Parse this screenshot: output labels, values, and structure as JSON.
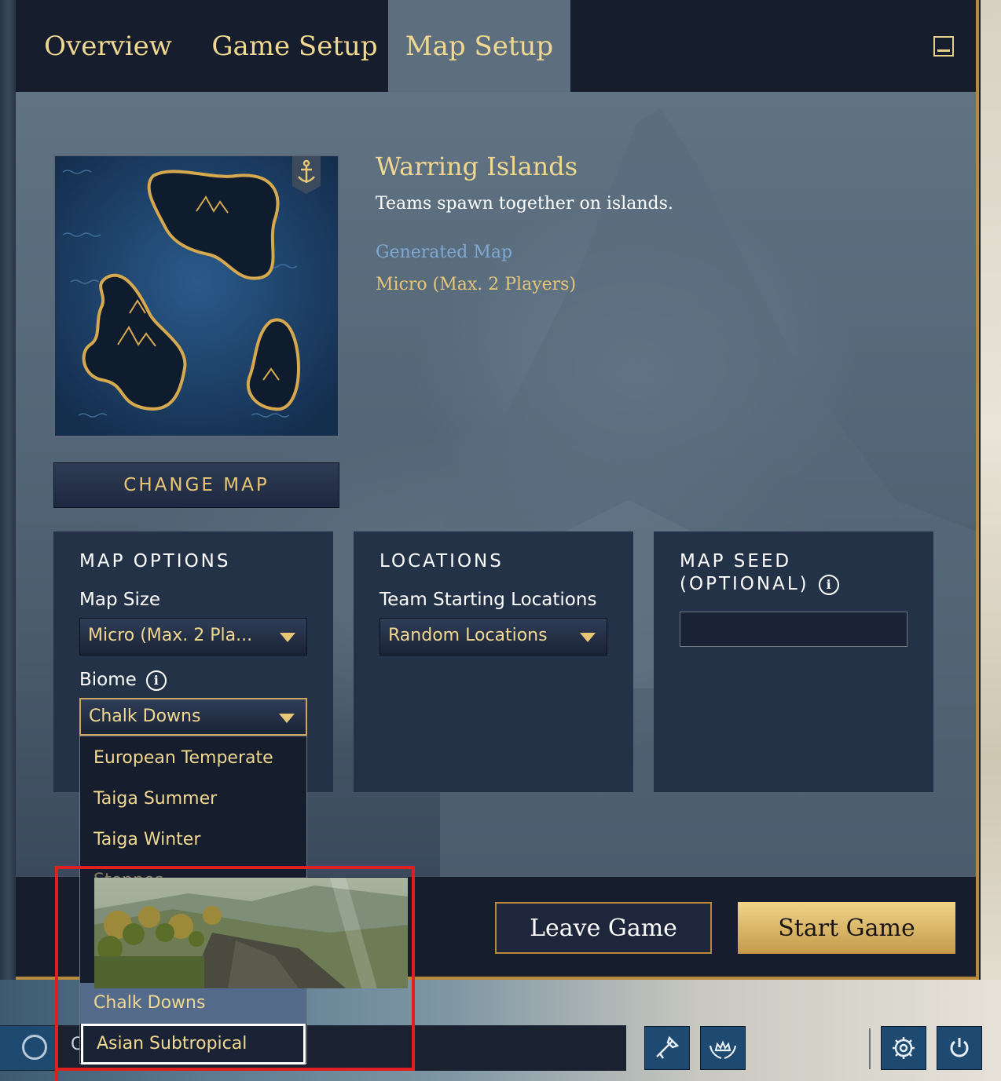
{
  "tabs": [
    {
      "label": "Overview"
    },
    {
      "label": "Game Setup"
    },
    {
      "label": "Map Setup",
      "active": true
    }
  ],
  "map": {
    "title": "Warring Islands",
    "description": "Teams spawn together on islands.",
    "type": "Generated Map",
    "size": "Micro (Max. 2 Players)",
    "change_button": "CHANGE MAP"
  },
  "map_options": {
    "heading": "MAP OPTIONS",
    "size_label": "Map Size",
    "size_value": "Micro (Max. 2 Pla...",
    "biome_label": "Biome",
    "biome_value": "Chalk Downs",
    "biome_options": [
      "European Temperate",
      "Taiga Summer",
      "Taiga Winter",
      "Steppes",
      "Chalk Downs",
      "Asian Subtropical"
    ],
    "biome_selected": "Chalk Downs",
    "biome_hovered": "Asian Subtropical"
  },
  "locations": {
    "heading": "LOCATIONS",
    "label": "Team Starting Locations",
    "value": "Random Locations"
  },
  "seed": {
    "heading_line1": "MAP SEED",
    "heading_line2": "(OPTIONAL)",
    "value": ""
  },
  "actions": {
    "leave": "Leave Game",
    "start": "Start Game"
  },
  "chat": {
    "initial": "C"
  },
  "colors": {
    "gold": "#f0d890",
    "accent_blue": "#7fa8d2",
    "highlight_red": "#e02020"
  },
  "icons": [
    "minimize-icon",
    "anchor-icon",
    "info-icon",
    "dropdown-arrow-icon",
    "social-icon",
    "trumpet-icon",
    "crown-laurel-icon",
    "gear-icon",
    "power-icon"
  ]
}
